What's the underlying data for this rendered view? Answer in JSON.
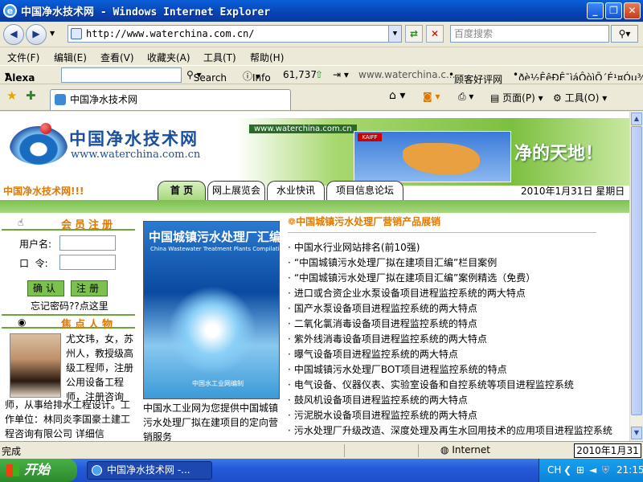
{
  "window": {
    "title": "中国净水技术网 - Windows Internet Explorer",
    "minimize": "_",
    "maximize": "❐",
    "close": "✕"
  },
  "browser": {
    "address": "http://www.waterchina.com.cn/",
    "search_placeholder": "百度搜索",
    "menu": [
      "文件(F)",
      "编辑(E)",
      "查看(V)",
      "收藏夹(A)",
      "工具(T)",
      "帮助(H)"
    ],
    "alexa": {
      "brand": "Alexa",
      "search_label": "Search",
      "info_label": "Info",
      "rank": "61,737",
      "site": "www.waterchina.c...",
      "review_link": "顾客好评网",
      "garbled": "ðè½ÊêÐÊ¯ìáÔòìÕ´É¹¤Óµ¾¿Ñêì"
    },
    "tab_title": "中国净水技术网",
    "tools": {
      "page": "页面(P)",
      "tools": "工具(O)"
    },
    "status": "完成",
    "zone": "Internet",
    "status_date": "2010年1月31日"
  },
  "site": {
    "logo_cn": "中国净水技术网",
    "logo_en": "www.waterchina.com.cn",
    "banner_url": "www.waterchina.com.cn",
    "banner_slogan": "净的天地！",
    "marquee": "中国净水技术网!!!",
    "nav": [
      "首 页",
      "网上展览会",
      "水业快讯",
      "项目信息论坛"
    ],
    "date": "2010年1月31日   星期日",
    "member": {
      "heading": "会员注册",
      "username_label": "用户名:",
      "password_label": "口  令:",
      "confirm_button": "确认",
      "register_button": "注册",
      "forgot": "忘记密码??点这里"
    },
    "focus": {
      "heading": "焦点人物",
      "bio_side": "尤文玮，女，苏州人，教授级高级工程师，注册公用设备工程师，注册咨询",
      "bio_below": "师，从事给排水工程设计。工作单位：林同炎李国豪土建工程咨询有限公司  详细信"
    },
    "book": {
      "title": "中国城镇污水处理厂汇编",
      "subtitle": "China Wastewater Treatment Plants Compilation",
      "publisher": "中国水工业网编制",
      "caption": "中国水工业网为您提供中国城镇污水处理厂拟在建项目的定向营销服务"
    },
    "news": {
      "heading": "中国城镇污水处理厂营销产品展销",
      "items": [
        "中国水行业网站排名(前10强)",
        "“中国城镇污水处理厂拟在建项目汇编”栏目案例",
        "“中国城镇污水处理厂拟在建项目汇编”案例精选（免费）",
        "进口或合资企业水泵设备项目进程监控系统的两大特点",
        "国产水泵设备项目进程监控系统的两大特点",
        "二氧化氯消毒设备项目进程监控系统的特点",
        "紫外线消毒设备项目进程监控系统的两大特点",
        "曝气设备项目进程监控系统的两大特点",
        "中国城镇污水处理厂BOT项目进程监控系统的特点",
        "电气设备、仪器仪表、实验室设备和自控系统等项目进程监控系统",
        "鼓风机设备项目进程监控系统的两大特点",
        "污泥脱水设备项目进程监控系统的两大特点",
        "污水处理厂升级改造、深度处理及再生水回用技术的应用项目进程监控系统"
      ]
    }
  },
  "taskbar": {
    "start": "开始",
    "item": "中国净水技术网 -...",
    "lang": "CH",
    "time": "21:15"
  }
}
